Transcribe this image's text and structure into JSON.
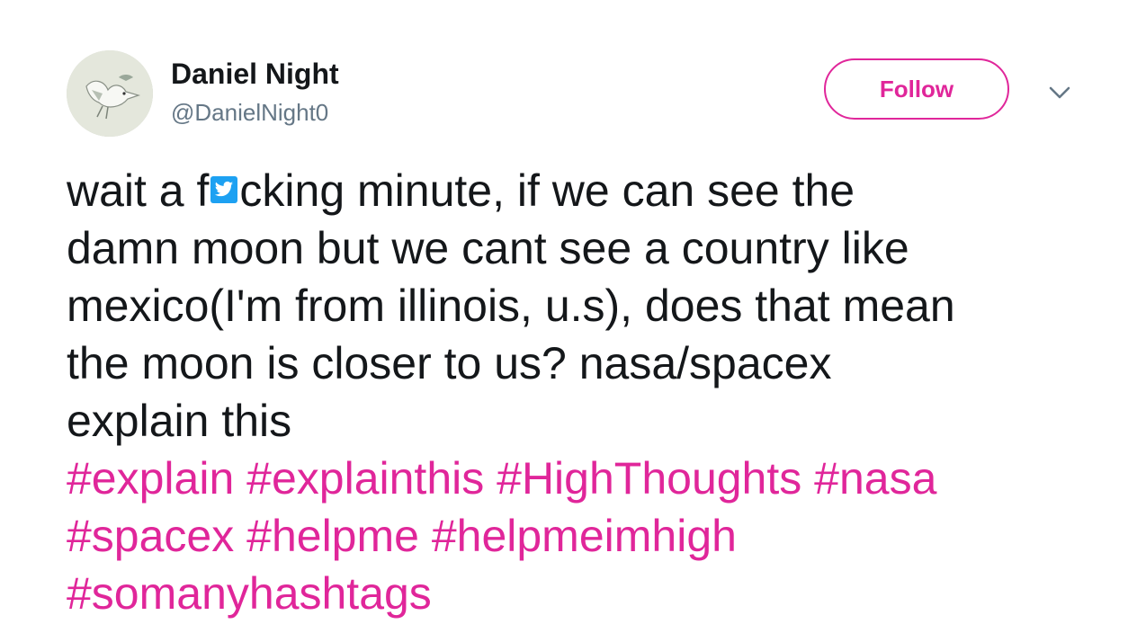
{
  "user": {
    "display_name": "Daniel Night",
    "handle": "@DanielNight0",
    "avatar_icon": "bird-avatar"
  },
  "actions": {
    "follow_label": "Follow",
    "more_icon": "chevron-down-icon"
  },
  "tweet": {
    "text_line1_a": "wait a f",
    "censor_icon": "twitter-bird-icon",
    "text_line1_b": "cking minute, if we can see the",
    "text_line2": "damn moon but we cant see a country like",
    "text_line3": "mexico(I'm from illinois, u.s), does that mean",
    "text_line4": "the moon is closer to us? nasa/spacex",
    "text_line5": "explain this",
    "hashtags": [
      "#explain",
      "#explainthis",
      "#HighThoughts",
      "#nasa",
      "#spacex",
      "#helpme",
      "#helpmeimhigh",
      "#somanyhashtags"
    ]
  },
  "colors": {
    "accent": "#e0269a",
    "text": "#14171a",
    "secondary_text": "#657786",
    "twitter_blue": "#1da1f2"
  }
}
